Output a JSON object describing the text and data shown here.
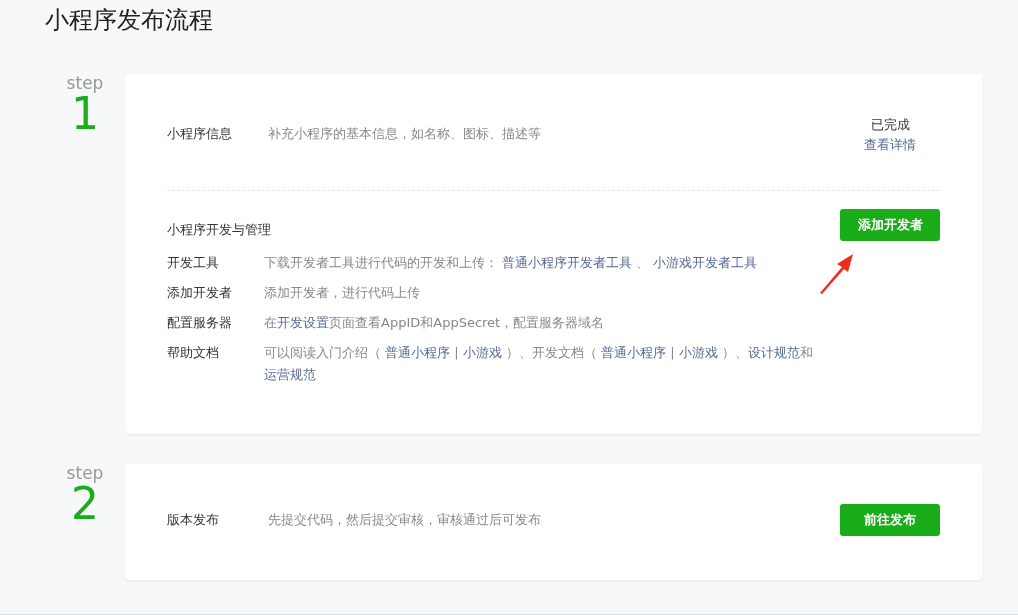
{
  "title": "小程序发布流程",
  "steps": [
    {
      "step_label": "step",
      "number": "1",
      "sections": [
        {
          "kind": "info",
          "label": "小程序信息",
          "desc": "补充小程序的基本信息，如名称、图标、描述等",
          "status": "已完成",
          "link": "查看详情"
        },
        {
          "kind": "list",
          "heading": "小程序开发与管理",
          "button": "添加开发者",
          "items": [
            {
              "label": "开发工具",
              "parts": [
                {
                  "text": "下载开发者工具进行代码的开发和上传： ",
                  "link": false
                },
                {
                  "text": "普通小程序开发者工具",
                  "link": true
                },
                {
                  "text": " 、 ",
                  "link": false
                },
                {
                  "text": "小游戏开发者工具",
                  "link": true
                }
              ]
            },
            {
              "label": "添加开发者",
              "parts": [
                {
                  "text": "添加开发者，进行代码上传",
                  "link": false
                }
              ]
            },
            {
              "label": "配置服务器",
              "parts": [
                {
                  "text": "在",
                  "link": false
                },
                {
                  "text": "开发设置",
                  "link": true
                },
                {
                  "text": "页面查看AppID和AppSecret，配置服务器域名",
                  "link": false
                }
              ]
            },
            {
              "label": "帮助文档",
              "parts": [
                {
                  "text": "可以阅读入门介绍（ ",
                  "link": false
                },
                {
                  "text": "普通小程序",
                  "link": true
                },
                {
                  "text": " | ",
                  "link": false
                },
                {
                  "text": "小游戏",
                  "link": true
                },
                {
                  "text": " ）、开发文档（ ",
                  "link": false
                },
                {
                  "text": "普通小程序",
                  "link": true
                },
                {
                  "text": " | ",
                  "link": false
                },
                {
                  "text": "小游戏",
                  "link": true
                },
                {
                  "text": " ）、",
                  "link": false
                },
                {
                  "text": "设计规范",
                  "link": true
                },
                {
                  "text": "和",
                  "link": false
                },
                {
                  "text": "运营规范",
                  "link": true
                }
              ]
            }
          ]
        }
      ]
    },
    {
      "step_label": "step",
      "number": "2",
      "sections": [
        {
          "kind": "info",
          "label": "版本发布",
          "desc": "先提交代码，然后提交审核，审核通过后可发布",
          "button": "前往发布"
        }
      ]
    }
  ]
}
